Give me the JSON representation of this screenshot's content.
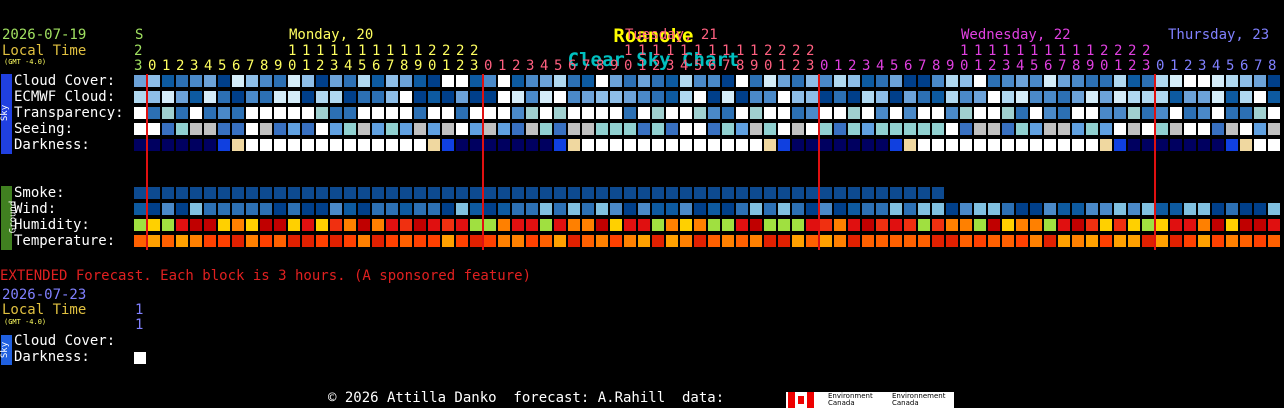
{
  "title": {
    "part1": "Roanoke",
    "part2": "Clear Sky Chart",
    "color1": "#ffff00",
    "color2": "#00c0c0"
  },
  "header": {
    "date": "2026-07-19",
    "local_time": "Local Time",
    "gmt": "(GMT -4.0)",
    "days": [
      {
        "label": "S",
        "color": "#a0e060"
      },
      {
        "label": "Monday, 20",
        "color": "#ffff60"
      },
      {
        "label": "Tuesday, 21",
        "color": "#ff6080"
      },
      {
        "label": "Wednesday, 22",
        "color": "#e040e0"
      },
      {
        "label": "Thursday, 23",
        "color": "#8080ff"
      }
    ]
  },
  "rows": {
    "sky_group": "Sky",
    "ground_group": "Ground",
    "cloud": "Cloud Cover:",
    "ecmwf": "ECMWF Cloud:",
    "transparency": "Transparency:",
    "seeing": "Seeing:",
    "darkness": "Darkness:",
    "smoke": "Smoke:",
    "wind": "Wind:",
    "humidity": "Humidity:",
    "temperature": "Temperature:"
  },
  "extended": {
    "notice": "EXTENDED Forecast. Each block is 3 hours. (A sponsored feature)",
    "date": "2026-07-23",
    "local_time": "Local Time",
    "gmt": "(GMT -4.0)",
    "hour_top": "1",
    "hour_bottom": "1",
    "sky_group": "Sky",
    "cloud": "Cloud Cover:",
    "darkness": "Darkness:"
  },
  "footer": {
    "text": "© 2026 Attilla Danko  forecast: A.Rahill  data:",
    "logo_en_1": "Environment",
    "logo_en_2": "Canada",
    "logo_fr_1": "Environnement",
    "logo_fr_2": "Canada"
  }
}
